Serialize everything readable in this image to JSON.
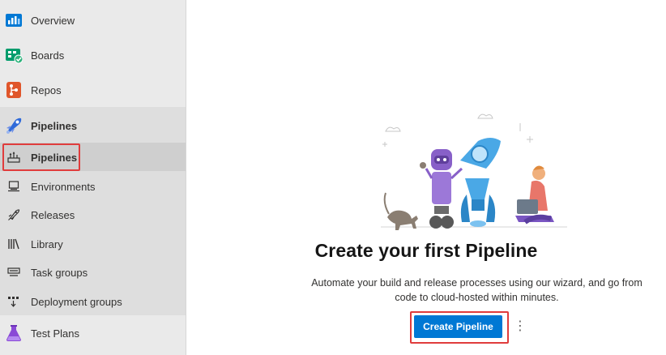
{
  "sidebar": {
    "items": [
      {
        "label": "Overview",
        "icon": "overview-icon"
      },
      {
        "label": "Boards",
        "icon": "boards-icon"
      },
      {
        "label": "Repos",
        "icon": "repos-icon"
      },
      {
        "label": "Pipelines",
        "icon": "pipelines-icon"
      },
      {
        "label": "Pipelines",
        "icon": "pipelines-sub-icon"
      },
      {
        "label": "Environments",
        "icon": "environments-icon"
      },
      {
        "label": "Releases",
        "icon": "rocket-icon"
      },
      {
        "label": "Library",
        "icon": "library-icon"
      },
      {
        "label": "Task groups",
        "icon": "task-groups-icon"
      },
      {
        "label": "Deployment groups",
        "icon": "deployment-groups-icon"
      },
      {
        "label": "Test Plans",
        "icon": "test-plans-icon"
      }
    ]
  },
  "main": {
    "title": "Create your first Pipeline",
    "description": "Automate your build and release processes using our wizard, and go from code to cloud-hosted within minutes.",
    "create_button": "Create Pipeline",
    "more_button": "⋮"
  },
  "colors": {
    "accent": "#0078d4",
    "highlight": "#e03c3c",
    "sidebar_bg": "#eaeaea"
  }
}
